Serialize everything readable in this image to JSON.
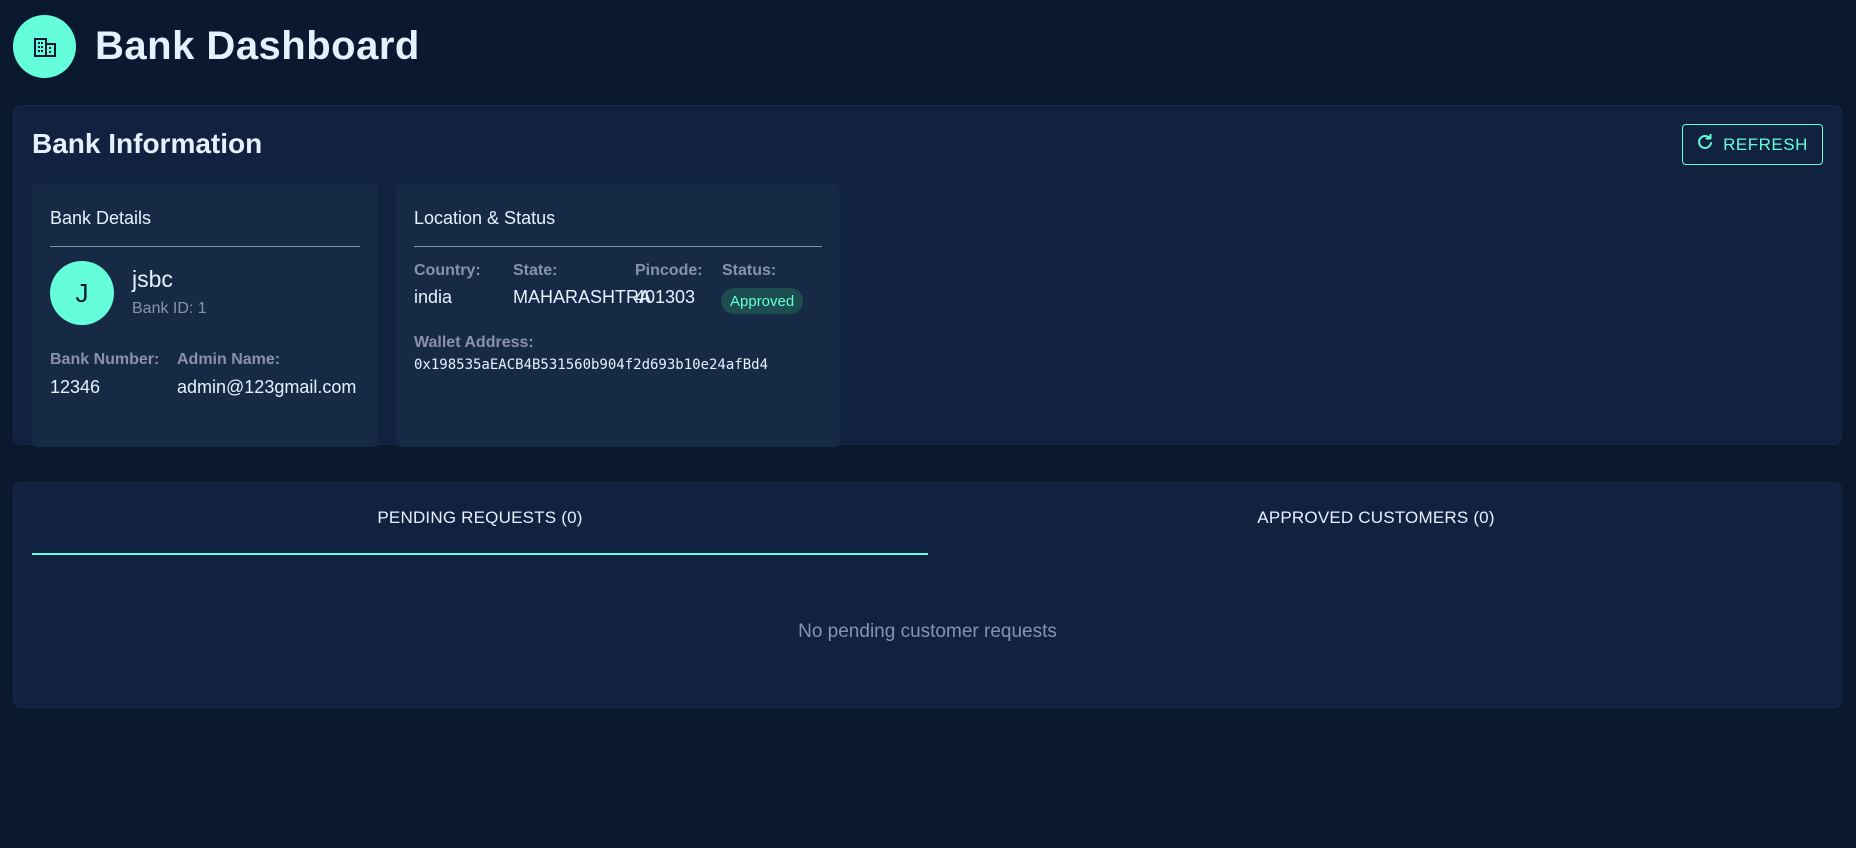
{
  "header": {
    "title": "Bank Dashboard",
    "logo_icon": "bank-building-icon"
  },
  "info_panel": {
    "title": "Bank Information",
    "refresh_label": "REFRESH",
    "refresh_icon": "refresh-icon"
  },
  "bank_details": {
    "title": "Bank Details",
    "avatar_initial": "J",
    "name": "jsbc",
    "bank_id": "Bank ID: 1",
    "bank_number_label": "Bank Number:",
    "bank_number": "12346",
    "admin_name_label": "Admin Name:",
    "admin_name": "admin@123gmail.com"
  },
  "location": {
    "title": "Location & Status",
    "country_label": "Country:",
    "country": "india",
    "state_label": "State:",
    "state": "MAHARASHTRA",
    "pincode_label": "Pincode:",
    "pincode": "401303",
    "status_label": "Status:",
    "status": "Approved",
    "wallet_label": "Wallet Address:",
    "wallet": "0x198535aEACB4B531560b904f2d693b10e24afBd4"
  },
  "tabs": {
    "pending_label": "PENDING REQUESTS (0)",
    "approved_label": "APPROVED CUSTOMERS (0)",
    "active": "pending",
    "empty_message": "No pending customer requests"
  },
  "colors": {
    "background": "#0a192f",
    "panel": "#112240",
    "card": "#172a45",
    "accent": "#64ffda",
    "muted": "#8892b0",
    "text": "#e6f1ff"
  }
}
